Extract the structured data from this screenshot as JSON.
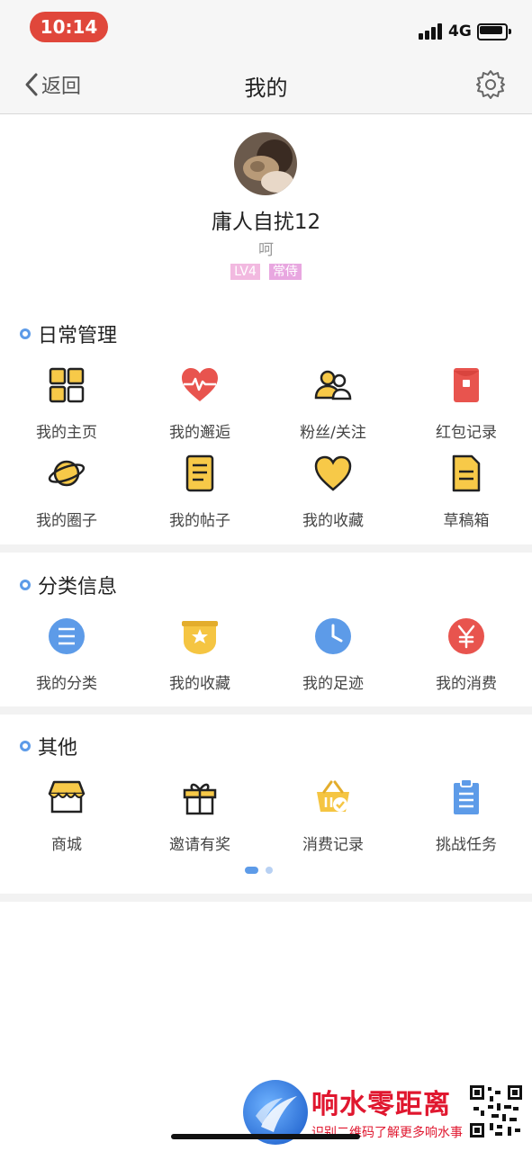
{
  "status_bar": {
    "time": "10:14",
    "network": "4G"
  },
  "nav": {
    "back_label": "返回",
    "title": "我的"
  },
  "profile": {
    "username": "庸人自扰12",
    "signature": "呵",
    "badges": [
      "LV4",
      "常侍"
    ]
  },
  "sections": [
    {
      "title": "日常管理",
      "items": [
        {
          "label": "我的主页",
          "icon": "grid-icon"
        },
        {
          "label": "我的邂逅",
          "icon": "heart-pulse-icon"
        },
        {
          "label": "粉丝/关注",
          "icon": "users-icon"
        },
        {
          "label": "红包记录",
          "icon": "red-envelope-icon"
        },
        {
          "label": "我的圈子",
          "icon": "planet-icon"
        },
        {
          "label": "我的帖子",
          "icon": "post-icon"
        },
        {
          "label": "我的收藏",
          "icon": "heart-icon"
        },
        {
          "label": "草稿箱",
          "icon": "draft-icon"
        }
      ]
    },
    {
      "title": "分类信息",
      "items": [
        {
          "label": "我的分类",
          "icon": "list-icon"
        },
        {
          "label": "我的收藏",
          "icon": "star-icon"
        },
        {
          "label": "我的足迹",
          "icon": "clock-icon"
        },
        {
          "label": "我的消费",
          "icon": "yen-icon"
        }
      ]
    },
    {
      "title": "其他",
      "items": [
        {
          "label": "商城",
          "icon": "shop-icon"
        },
        {
          "label": "邀请有奖",
          "icon": "gift-icon"
        },
        {
          "label": "消费记录",
          "icon": "basket-icon"
        },
        {
          "label": "挑战任务",
          "icon": "clipboard-icon"
        }
      ]
    }
  ],
  "watermark": {
    "title": "响水零距离",
    "subtitle": "识别二维码了解更多响水事"
  },
  "colors": {
    "accent": "#5d9be8",
    "red": "#e8544e",
    "yellow": "#f5c542",
    "badge_pink": "#f2b9e0",
    "status_pill": "#e0473b"
  }
}
